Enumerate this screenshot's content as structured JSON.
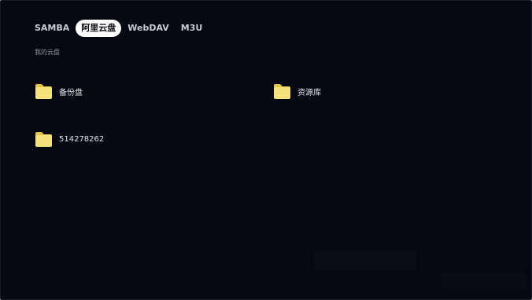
{
  "tabs": [
    {
      "label": "SAMBA",
      "active": false
    },
    {
      "label": "阿里云盘",
      "active": true
    },
    {
      "label": "WebDAV",
      "active": false
    },
    {
      "label": "M3U",
      "active": false
    }
  ],
  "breadcrumb": "我的云盘",
  "folders": [
    {
      "label": "备份盘",
      "icon": "folder-icon"
    },
    {
      "label": "资源库",
      "icon": "folder-icon"
    },
    {
      "label": "514278262",
      "icon": "folder-icon"
    }
  ],
  "colors": {
    "background": "#060812",
    "active_tab_bg": "#ffffff",
    "folder_yellow": "#f6e27a",
    "folder_dark": "#e4c444"
  }
}
